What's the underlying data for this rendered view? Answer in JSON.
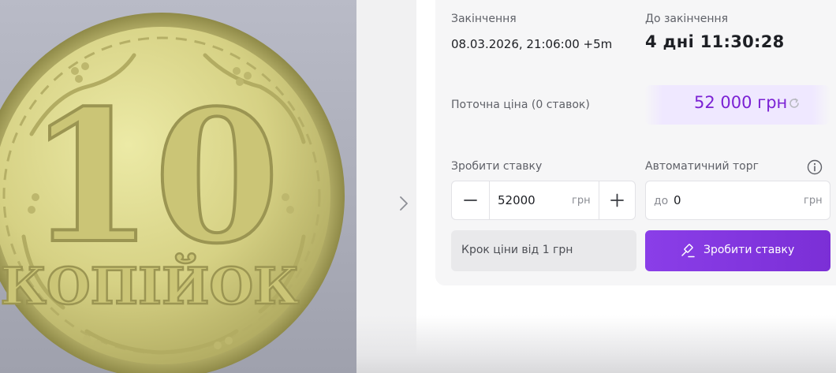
{
  "coin_image": {
    "numeral": "10",
    "denomination": "КОПІЙОК"
  },
  "auction": {
    "end_label": "Закінчення",
    "end_value": "08.03.2026, 21:06:00 +5m",
    "remaining_label": "До закінчення",
    "remaining_value": "4 дні 11:30:28",
    "current_price_label": "Поточна ціна (0 ставок)",
    "current_price_value": "52 000 грн",
    "bid_label": "Зробити ставку",
    "bid_value": "52000",
    "bid_currency": "грн",
    "auto_label": "Автоматичний торг",
    "auto_prefix": "до",
    "auto_value": "0",
    "auto_currency": "грн",
    "step_text": "Крок ціни від 1 грн",
    "submit_label": "Зробити ставку"
  },
  "colors": {
    "accent": "#7b2fd6",
    "price_text": "#7b22d4",
    "price_bg": "#efe8ff"
  },
  "icons": [
    "chevron-right-icon",
    "refresh-icon",
    "minus-icon",
    "plus-icon",
    "info-icon",
    "gavel-icon"
  ]
}
